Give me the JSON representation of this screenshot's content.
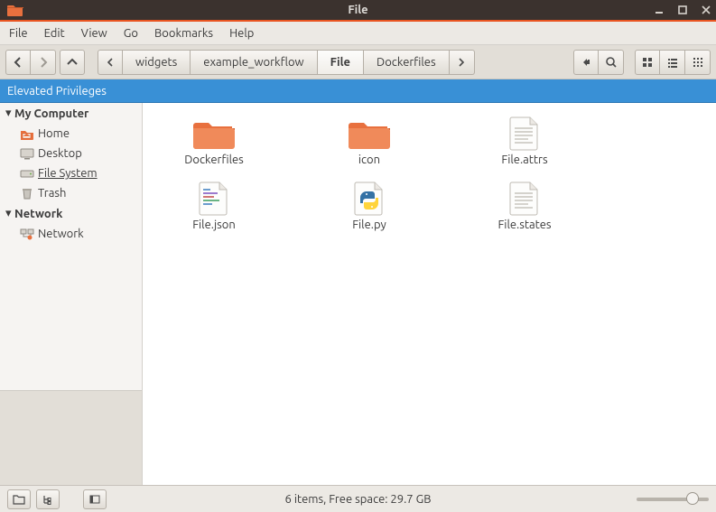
{
  "window": {
    "title": "File"
  },
  "menubar": [
    "File",
    "Edit",
    "View",
    "Go",
    "Bookmarks",
    "Help"
  ],
  "breadcrumbs": {
    "items": [
      "widgets",
      "example_workflow",
      "File",
      "Dockerfiles"
    ],
    "active_index": 2
  },
  "banner": "Elevated Privileges",
  "sidebar": {
    "sections": [
      {
        "title": "My Computer",
        "items": [
          {
            "label": "Home",
            "icon": "home-folder"
          },
          {
            "label": "Desktop",
            "icon": "desktop"
          },
          {
            "label": "File System",
            "icon": "drive",
            "selected": true
          },
          {
            "label": "Trash",
            "icon": "trash"
          }
        ]
      },
      {
        "title": "Network",
        "items": [
          {
            "label": "Network",
            "icon": "network"
          }
        ]
      }
    ]
  },
  "files": [
    {
      "name": "Dockerfiles",
      "type": "folder"
    },
    {
      "name": "icon",
      "type": "folder"
    },
    {
      "name": "File.attrs",
      "type": "text"
    },
    {
      "name": "File.json",
      "type": "code"
    },
    {
      "name": "File.py",
      "type": "python"
    },
    {
      "name": "File.states",
      "type": "text"
    }
  ],
  "status": {
    "text": "6 items, Free space: 29.7 GB"
  }
}
